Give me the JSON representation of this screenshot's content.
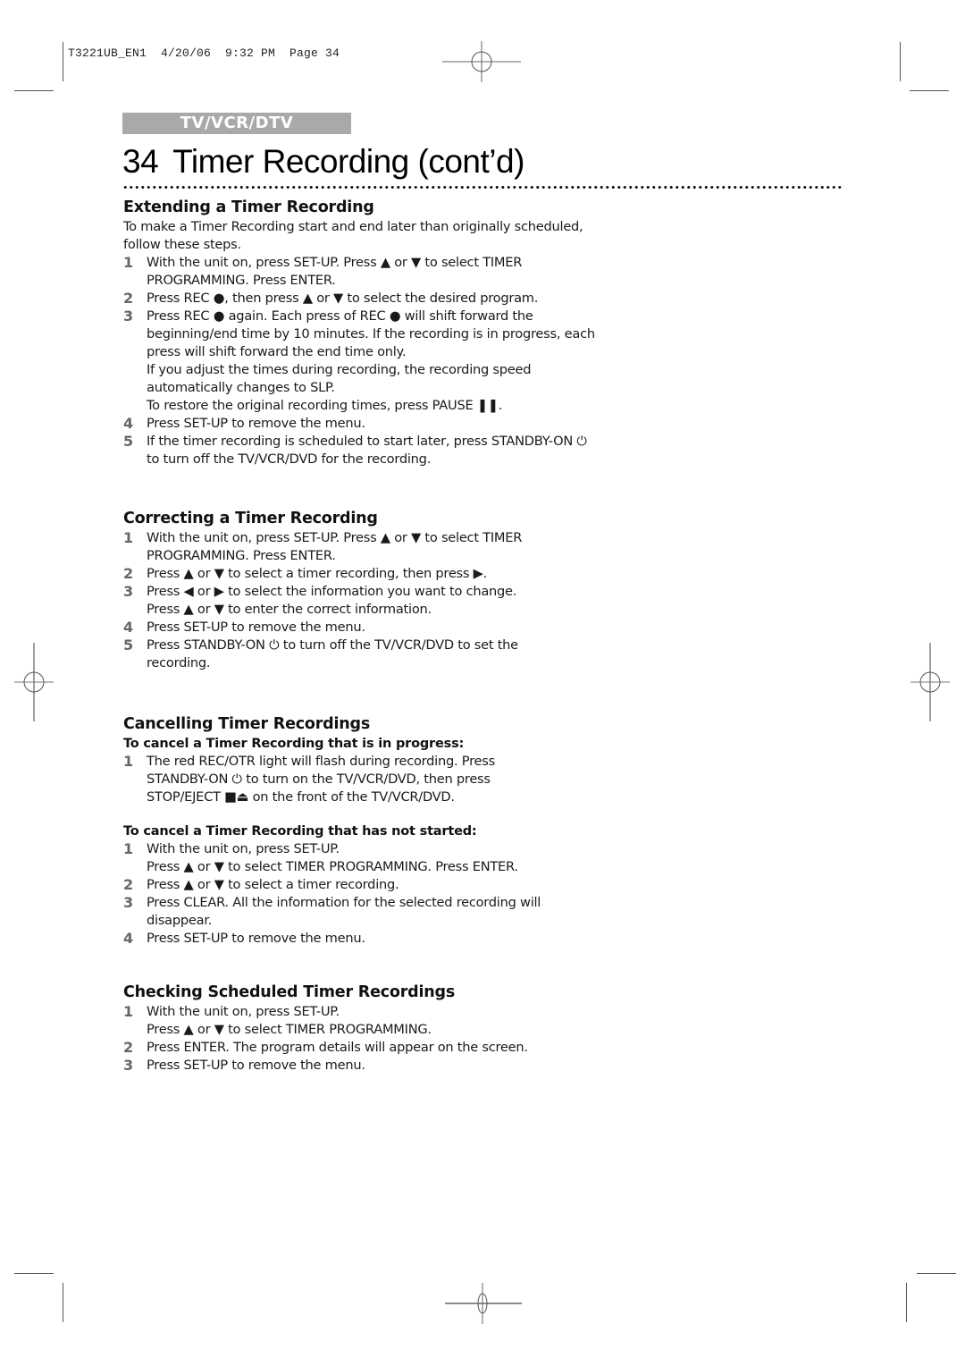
{
  "print_slug": "T3221UB_EN1  4/20/06  9:32 PM  Page 34",
  "section_tab": "TV/VCR/DTV",
  "page_title": {
    "number": "34",
    "text": "Timer Recording (cont’d)"
  },
  "sections": {
    "extending": {
      "heading": "Extending a Timer Recording",
      "intro": [
        "To make a Timer Recording start and end later than originally scheduled,",
        "follow these steps."
      ],
      "steps": [
        {
          "n": "1",
          "lines": [
            "With the unit on, press SET-UP. Press ▲ or ▼ to select TIMER",
            "PROGRAMMING. Press ENTER."
          ]
        },
        {
          "n": "2",
          "lines": [
            "Press REC ●, then press ▲ or ▼ to select the desired program."
          ]
        },
        {
          "n": "3",
          "lines": [
            "Press REC ● again. Each press of REC ● will shift forward the",
            "beginning/end time by 10 minutes. If the recording is in progress, each",
            "press will shift forward the end time only.",
            "If you adjust the times during recording, the recording speed",
            "automatically changes to SLP.",
            "To restore the original recording times, press PAUSE ❚❚."
          ]
        },
        {
          "n": "4",
          "lines": [
            "Press SET-UP to remove the menu."
          ]
        },
        {
          "n": "5",
          "lines": [
            "If the timer recording is scheduled to start later, press STANDBY-ON ⏻",
            "to turn off the TV/VCR/DVD for the recording."
          ]
        }
      ]
    },
    "correcting": {
      "heading": "Correcting a Timer Recording",
      "steps": [
        {
          "n": "1",
          "lines": [
            "With the unit on, press SET-UP. Press ▲ or ▼ to select TIMER",
            "PROGRAMMING. Press ENTER."
          ]
        },
        {
          "n": "2",
          "lines": [
            "Press ▲ or ▼ to select a timer recording, then press ▶."
          ]
        },
        {
          "n": "3",
          "lines": [
            "Press ◀ or ▶ to select the information you want to change.",
            "Press ▲ or ▼ to enter the correct information."
          ]
        },
        {
          "n": "4",
          "lines": [
            "Press SET-UP to remove the menu."
          ]
        },
        {
          "n": "5",
          "lines": [
            "Press STANDBY-ON ⏻ to turn off the TV/VCR/DVD to set the",
            "recording."
          ]
        }
      ]
    },
    "cancelling": {
      "heading": "Cancelling Timer Recordings",
      "in_progress": {
        "subheading": "To cancel a Timer Recording that is in progress:",
        "steps": [
          {
            "n": "1",
            "lines": [
              "The red REC/OTR light will flash during recording. Press",
              "STANDBY-ON ⏻ to turn on the TV/VCR/DVD, then press",
              "STOP/EJECT ■⏏ on the front of the TV/VCR/DVD."
            ]
          }
        ]
      },
      "not_started": {
        "subheading": "To cancel a Timer Recording that has not started:",
        "steps": [
          {
            "n": "1",
            "lines": [
              "With the unit on, press SET-UP.",
              "Press ▲ or ▼ to select TIMER PROGRAMMING. Press ENTER."
            ]
          },
          {
            "n": "2",
            "lines": [
              "Press ▲ or ▼ to select a timer recording."
            ]
          },
          {
            "n": "3",
            "lines": [
              "Press CLEAR. All the information for the selected recording will",
              "disappear."
            ]
          },
          {
            "n": "4",
            "lines": [
              "Press SET-UP to remove the menu."
            ]
          }
        ]
      }
    },
    "checking": {
      "heading": "Checking Scheduled Timer Recordings",
      "steps": [
        {
          "n": "1",
          "lines": [
            "With the unit on, press SET-UP.",
            "Press ▲ or ▼ to select TIMER PROGRAMMING."
          ]
        },
        {
          "n": "2",
          "lines": [
            "Press ENTER. The program details will appear on the screen."
          ]
        },
        {
          "n": "3",
          "lines": [
            "Press SET-UP to remove the menu."
          ]
        }
      ]
    }
  }
}
